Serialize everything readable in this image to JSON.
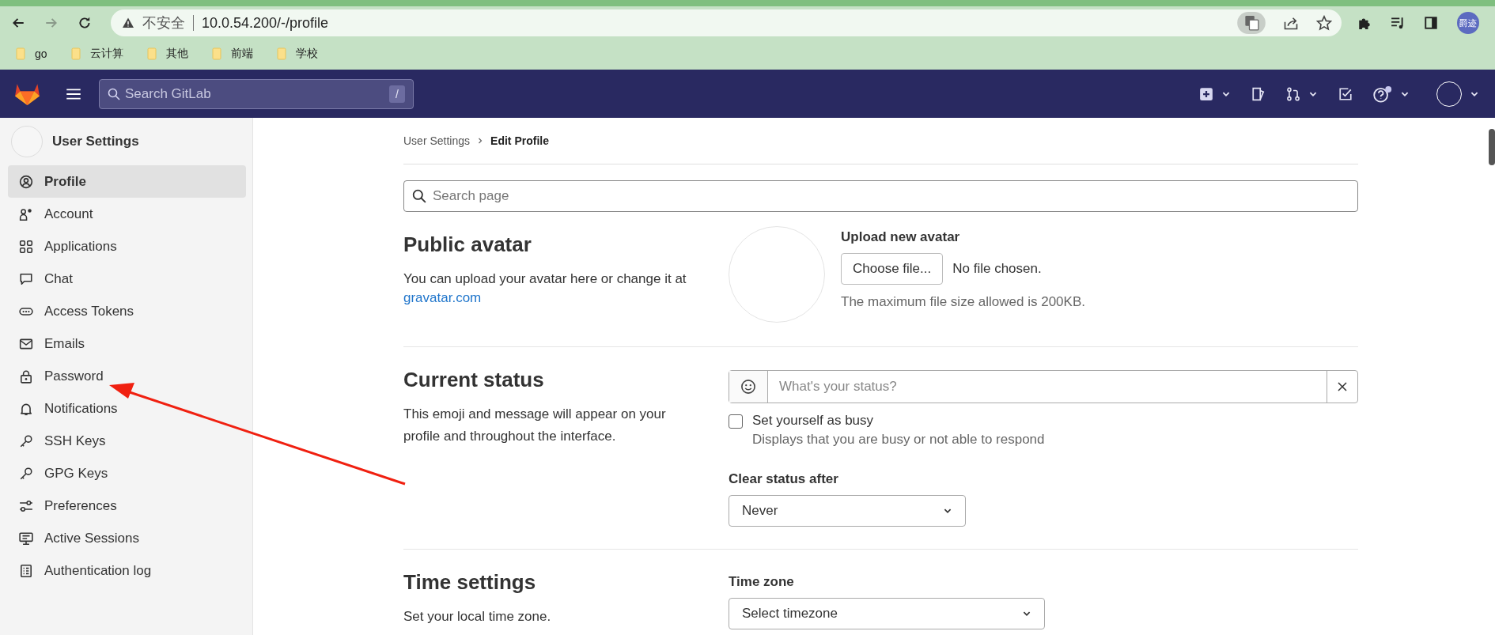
{
  "browser": {
    "security_label": "不安全",
    "url": "10.0.54.200/-/profile",
    "profile_badge": "爵迹",
    "bookmarks": [
      "go",
      "云计算",
      "其他",
      "前端",
      "学校"
    ]
  },
  "navbar": {
    "search_placeholder": "Search GitLab",
    "shortcut": "/"
  },
  "sidebar": {
    "title": "User Settings",
    "items": [
      {
        "label": "Profile",
        "selected": true
      },
      {
        "label": "Account",
        "selected": false
      },
      {
        "label": "Applications",
        "selected": false
      },
      {
        "label": "Chat",
        "selected": false
      },
      {
        "label": "Access Tokens",
        "selected": false
      },
      {
        "label": "Emails",
        "selected": false
      },
      {
        "label": "Password",
        "selected": false
      },
      {
        "label": "Notifications",
        "selected": false
      },
      {
        "label": "SSH Keys",
        "selected": false
      },
      {
        "label": "GPG Keys",
        "selected": false
      },
      {
        "label": "Preferences",
        "selected": false
      },
      {
        "label": "Active Sessions",
        "selected": false
      },
      {
        "label": "Authentication log",
        "selected": false
      }
    ]
  },
  "breadcrumb": [
    "User Settings",
    "Edit Profile"
  ],
  "search_page": {
    "placeholder": "Search page"
  },
  "public_avatar": {
    "title": "Public avatar",
    "description": "You can upload your avatar here or change it at",
    "link": "gravatar.com",
    "upload_label": "Upload new avatar",
    "button": "Choose file...",
    "file_status": "No file chosen.",
    "hint": "The maximum file size allowed is 200KB."
  },
  "current_status": {
    "title": "Current status",
    "description": "This emoji and message will appear on your profile and throughout the interface.",
    "status_placeholder": "What's your status?",
    "busy": {
      "label": "Set yourself as busy",
      "hint": "Displays that you are busy or not able to respond",
      "checked": false
    },
    "clear_after": {
      "label": "Clear status after",
      "value": "Never"
    }
  },
  "time_settings": {
    "title": "Time settings",
    "description": "Set your local time zone.",
    "timezone": {
      "label": "Time zone",
      "value": "Select timezone"
    }
  }
}
